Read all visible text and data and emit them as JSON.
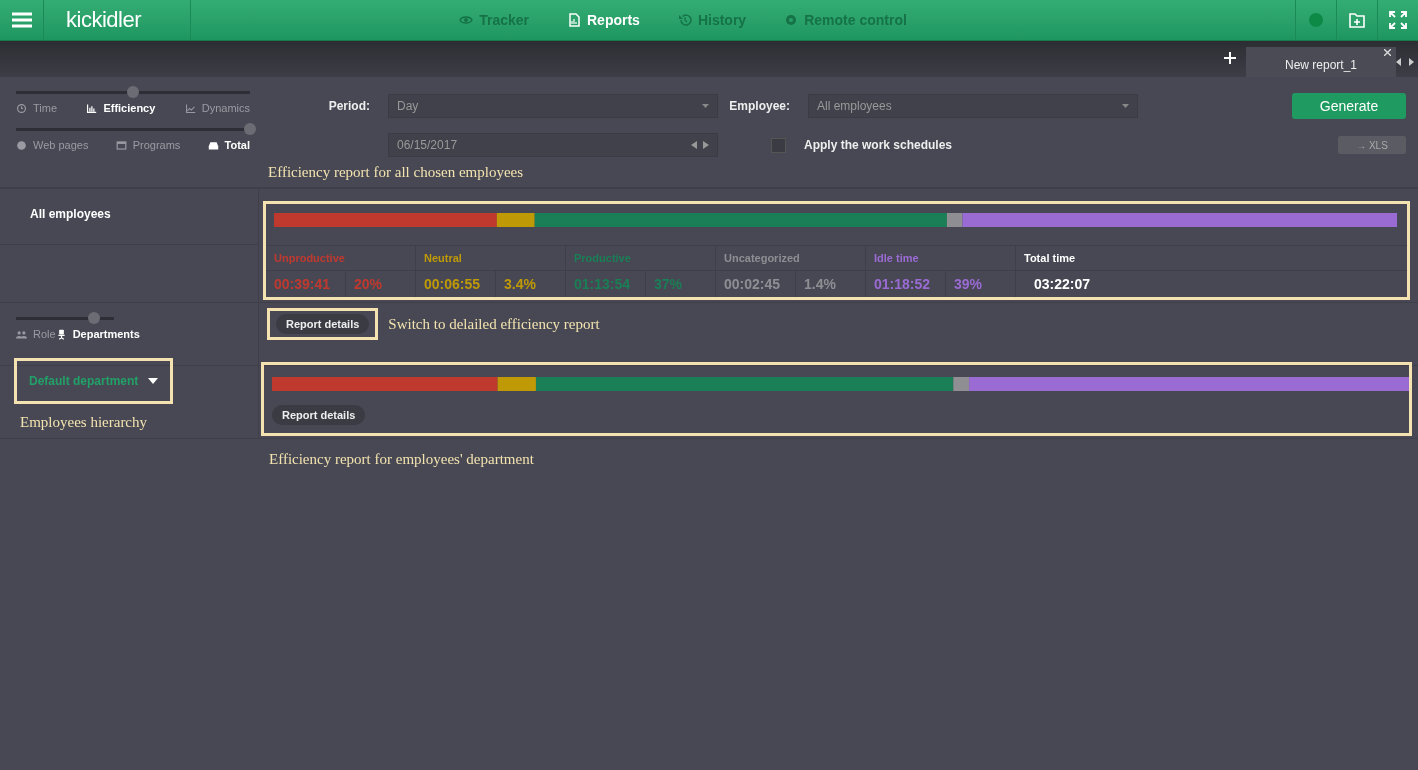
{
  "header": {
    "logo": "kickidler",
    "nav": [
      {
        "label": "Tracker",
        "selected": false
      },
      {
        "label": "Reports",
        "selected": true
      },
      {
        "label": "History",
        "selected": false
      },
      {
        "label": "Remote control",
        "selected": false
      }
    ]
  },
  "tabs": [
    {
      "label": "New report_1",
      "selected": true
    }
  ],
  "report_type": {
    "level": 0.5,
    "options": [
      {
        "label": "Time",
        "selected": false
      },
      {
        "label": "Efficiency",
        "selected": true
      },
      {
        "label": "Dynamics",
        "selected": false
      }
    ]
  },
  "scope": {
    "level": 1,
    "options": [
      {
        "label": "Web pages",
        "selected": false
      },
      {
        "label": "Programs",
        "selected": false
      },
      {
        "label": "Total",
        "selected": true
      }
    ]
  },
  "form": {
    "period_label": "Period:",
    "period": "Day",
    "date": "06/15/2017",
    "employee_label": "Employee:",
    "employee": "All employees",
    "schedule": {
      "label": "Apply the work schedules",
      "checked": false
    },
    "generate": "Generate",
    "xls": "→ XLS"
  },
  "annotations": [
    "Efficiency report for all chosen employees",
    "Switch to delailed efficiency report",
    "Employees hierarchy",
    "Efficiency report for employees' department"
  ],
  "summary": {
    "name": "All employees",
    "stats": [
      {
        "label": "Unproductive",
        "time": "00:39:41",
        "percent": "20%",
        "color": "#c0392f"
      },
      {
        "label": "Neutral",
        "time": "00:06:55",
        "percent": "3.4%",
        "color": "#c09a06"
      },
      {
        "label": "Productive",
        "time": "01:13:54",
        "percent": "37%",
        "color": "#1a7f56"
      },
      {
        "label": "Uncategorized",
        "time": "00:02:45",
        "percent": "1.4%",
        "color": "#8e8e93"
      },
      {
        "label": "Idle time",
        "time": "01:18:52",
        "percent": "39%",
        "color": "#9b6bd4"
      }
    ],
    "total": {
      "label": "Total time",
      "value": "03:22:07"
    },
    "details": "Report details"
  },
  "hierarchy": {
    "level": 0.8,
    "options": [
      {
        "label": "Role",
        "selected": false
      },
      {
        "label": "Departments",
        "selected": true
      }
    ]
  },
  "department": {
    "name": "Default department",
    "details": "Report details"
  }
}
